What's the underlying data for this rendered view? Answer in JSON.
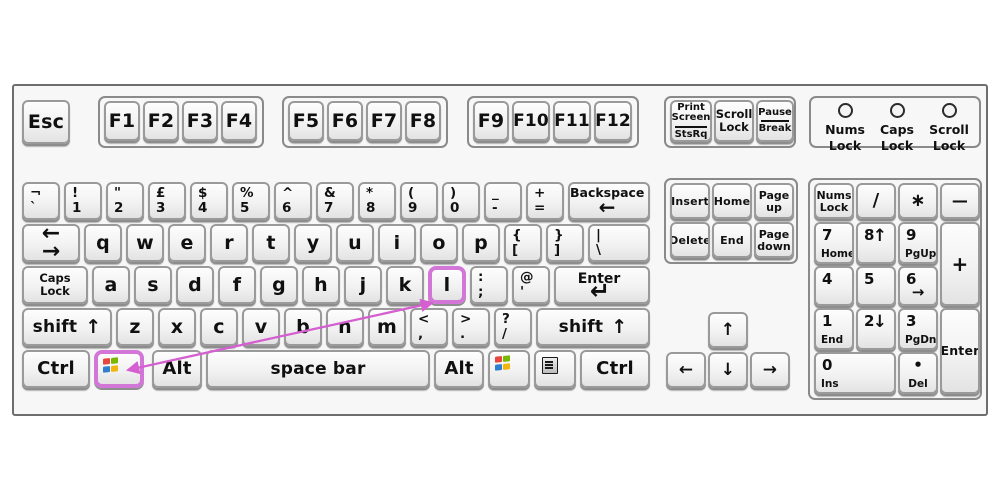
{
  "diagram": {
    "title": "UK keyboard layout diagram",
    "highlight_color": "#d277d8",
    "highlighted_keys": [
      "windows-left",
      "l"
    ],
    "connector": "double-headed arrow linking Windows key and L key"
  },
  "function_row": {
    "escape": "Esc",
    "f_block_1": [
      "F1",
      "F2",
      "F3",
      "F4"
    ],
    "f_block_2": [
      "F5",
      "F6",
      "F7",
      "F8"
    ],
    "f_block_3": [
      "F9",
      "F10",
      "F11",
      "F12"
    ],
    "system": [
      {
        "name": "print-screen",
        "top": "Print",
        "top2": "Screen",
        "bottom": "StsRq"
      },
      {
        "name": "scroll-lock",
        "line1": "Scroll",
        "line2": "Lock"
      },
      {
        "name": "pause-break",
        "line1": "Pause",
        "line2": "Break"
      }
    ],
    "leds": [
      {
        "name": "nums-lock",
        "line1": "Nums",
        "line2": "Lock"
      },
      {
        "name": "caps-lock",
        "line1": "Caps",
        "line2": "Lock"
      },
      {
        "name": "scroll-lock",
        "line1": "Scroll",
        "line2": "Lock"
      }
    ]
  },
  "main": {
    "row_number": [
      {
        "shift": "¬",
        "base": "`"
      },
      {
        "shift": "!",
        "base": "1"
      },
      {
        "shift": "\"",
        "base": "2"
      },
      {
        "shift": "£",
        "base": "3"
      },
      {
        "shift": "$",
        "base": "4"
      },
      {
        "shift": "%",
        "base": "5"
      },
      {
        "shift": "^",
        "base": "6"
      },
      {
        "shift": "&",
        "base": "7"
      },
      {
        "shift": "*",
        "base": "8"
      },
      {
        "shift": "(",
        "base": "9"
      },
      {
        "shift": ")",
        "base": "0"
      },
      {
        "shift": "_",
        "base": "-"
      },
      {
        "shift": "+",
        "base": "="
      }
    ],
    "backspace": {
      "label": "Backspace",
      "arrow": "←"
    },
    "tab": {
      "arrow_top": "←",
      "arrow_bottom": "→"
    },
    "row_q": [
      "q",
      "w",
      "e",
      "r",
      "t",
      "y",
      "u",
      "i",
      "o",
      "p"
    ],
    "row_q_extra": [
      {
        "shift": "{",
        "base": "["
      },
      {
        "shift": "}",
        "base": "]"
      },
      {
        "shift": "|",
        "base": "\\"
      }
    ],
    "caps_lock": {
      "line1": "Caps",
      "line2": "Lock"
    },
    "row_a": [
      "a",
      "s",
      "d",
      "f",
      "g",
      "h",
      "j",
      "k",
      "l"
    ],
    "row_a_extra": [
      {
        "shift": ":",
        "base": ";"
      },
      {
        "shift": "@",
        "base": "'"
      }
    ],
    "enter": {
      "label": "Enter",
      "arrow": "↵"
    },
    "shift_left": {
      "label": "shift",
      "arrow": "↑"
    },
    "row_z": [
      "z",
      "x",
      "c",
      "v",
      "b",
      "n",
      "m"
    ],
    "row_z_extra": [
      {
        "shift": "<",
        "base": ","
      },
      {
        "shift": ">",
        "base": "."
      },
      {
        "shift": "?",
        "base": "/"
      }
    ],
    "shift_right": {
      "label": "shift",
      "arrow": "↑"
    },
    "bottom_row": {
      "ctrl_left": "Ctrl",
      "win_left": "windows-logo",
      "alt_left": "Alt",
      "space": "space bar",
      "alt_right": "Alt",
      "win_right": "windows-logo",
      "menu": "menu-key",
      "ctrl_right": "Ctrl"
    }
  },
  "nav": {
    "cluster": [
      [
        "Insert",
        "Home",
        "Page up"
      ],
      [
        "Delete",
        "End",
        "Page down"
      ]
    ],
    "page_up": {
      "line1": "Page",
      "line2": "up"
    },
    "page_down": {
      "line1": "Page",
      "line2": "down"
    },
    "arrows": {
      "up": "↑",
      "left": "←",
      "down": "↓",
      "right": "→"
    }
  },
  "numpad": {
    "num_lock": {
      "line1": "Nums",
      "line2": "Lock"
    },
    "divide": "/",
    "multiply": "∗",
    "minus": "—",
    "plus": "+",
    "enter": "Enter",
    "keys": [
      {
        "digit": "7",
        "caption": "Home"
      },
      {
        "digit": "8",
        "arrow": "↑"
      },
      {
        "digit": "9",
        "caption": "PgUp"
      },
      {
        "digit": "4",
        "caption": ""
      },
      {
        "digit": "5",
        "caption": ""
      },
      {
        "digit": "6",
        "arrow_bottom": "→"
      },
      {
        "digit": "1",
        "caption": "End"
      },
      {
        "digit": "2",
        "arrow": "↓"
      },
      {
        "digit": "3",
        "caption": "PgDn"
      },
      {
        "digit": "0",
        "caption": "Ins"
      },
      {
        "digit": "•",
        "caption": "Del"
      }
    ]
  }
}
